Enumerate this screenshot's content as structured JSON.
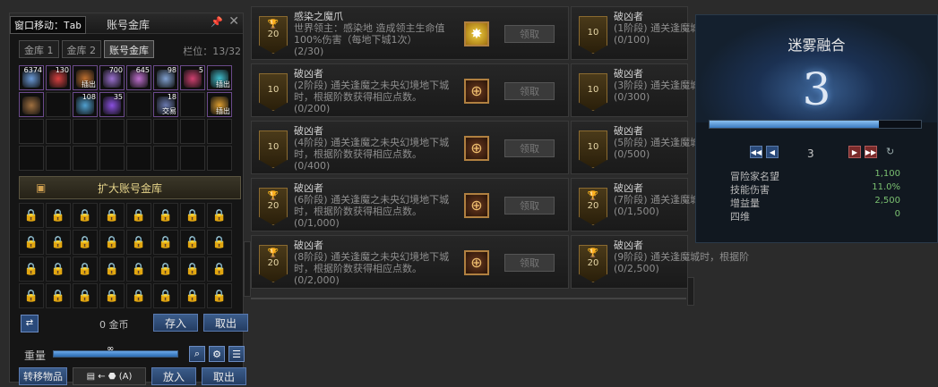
{
  "storage": {
    "hint": "窗口移动：Tab",
    "title": "账号金库",
    "tabs": [
      "金库 1",
      "金库 2",
      "账号金库"
    ],
    "capacity": "栏位：13/32",
    "items": [
      {
        "count": "6374",
        "tag": "",
        "color": "#6a9ad8"
      },
      {
        "count": "130",
        "tag": "",
        "color": "#d84040"
      },
      {
        "count": "",
        "tag": "插出",
        "color": "#c07030"
      },
      {
        "count": "700",
        "tag": "",
        "color": "#9a70d0"
      },
      {
        "count": "645",
        "tag": "",
        "color": "#c070d0"
      },
      {
        "count": "98",
        "tag": "",
        "color": "#80a0d0"
      },
      {
        "count": "5",
        "tag": "",
        "color": "#d04070"
      },
      {
        "count": "",
        "tag": "插出",
        "color": "#40c0d0"
      },
      {
        "count": "",
        "tag": "",
        "color": "#a07040"
      },
      {
        "count": "",
        "tag": "",
        "color": ""
      },
      {
        "count": "108",
        "tag": "",
        "color": "#50a0d0"
      },
      {
        "count": "35",
        "tag": "",
        "color": "#8a50e0"
      },
      {
        "count": "",
        "tag": "",
        "color": ""
      },
      {
        "count": "18",
        "tag": "交易",
        "color": "#6a7ab0"
      },
      {
        "count": "",
        "tag": "",
        "color": ""
      },
      {
        "count": "",
        "tag": "插出",
        "color": "#e0a030"
      }
    ],
    "expand_label": "扩大账号金库",
    "gold_amount": "0 金币",
    "deposit_label": "存入",
    "withdraw_label": "取出",
    "weight_label": "重量",
    "weight_value": "∞",
    "transfer_label": "转移物品",
    "transfer_hint": "(A)",
    "put_label": "放入",
    "take_label": "取出"
  },
  "achievements": {
    "claim_label": "领取",
    "left": [
      {
        "title": "感染之魔爪",
        "desc": "世界领主：感染地 造成领主生命值100%伤害（每地下城1次）",
        "progress": "(2/30)",
        "points": "20",
        "trophy": true,
        "gold": true
      },
      {
        "title": "破凶者",
        "desc": "(2阶段) 通关逢魔之未央幻境地下城时，根据阶数获得相应点数。",
        "progress": "(0/200)",
        "points": "10",
        "trophy": false,
        "gold": false
      },
      {
        "title": "破凶者",
        "desc": "(4阶段) 通关逢魔之未央幻境地下城时，根据阶数获得相应点数。",
        "progress": "(0/400)",
        "points": "10",
        "trophy": false,
        "gold": false
      },
      {
        "title": "破凶者",
        "desc": "(6阶段) 通关逢魔之未央幻境地下城时，根据阶数获得相应点数。",
        "progress": "(0/1,000)",
        "points": "20",
        "trophy": true,
        "gold": false
      },
      {
        "title": "破凶者",
        "desc": "(8阶段) 通关逢魔之未央幻境地下城时，根据阶数获得相应点数。",
        "progress": "(0/2,000)",
        "points": "20",
        "trophy": true,
        "gold": false
      }
    ],
    "right": [
      {
        "title": "破凶者",
        "desc": "(1阶段) 通关逢魔城时，根据阶",
        "progress": "(0/100)",
        "points": "10",
        "trophy": false
      },
      {
        "title": "破凶者",
        "desc": "(3阶段) 通关逢魔城时，根据阶",
        "progress": "(0/300)",
        "points": "10",
        "trophy": false
      },
      {
        "title": "破凶者",
        "desc": "(5阶段) 通关逢魔城时，根据阶",
        "progress": "(0/500)",
        "points": "10",
        "trophy": false
      },
      {
        "title": "破凶者",
        "desc": "(7阶段) 通关逢魔城时，根据阶",
        "progress": "(0/1,500)",
        "points": "20",
        "trophy": true
      },
      {
        "title": "破凶者",
        "desc": "(9阶段) 通关逢魔城时，根据阶",
        "progress": "(0/2,500)",
        "points": "20",
        "trophy": true
      }
    ]
  },
  "fusion": {
    "title": "迷雾融合",
    "level": "3",
    "progress": 0.8,
    "page": "3",
    "stats": [
      {
        "name": "冒险家名望",
        "value": "1,100"
      },
      {
        "name": "技能伤害",
        "value": "11.0%"
      },
      {
        "name": "增益量",
        "value": "2,500"
      },
      {
        "name": "四维",
        "value": "0"
      }
    ]
  }
}
